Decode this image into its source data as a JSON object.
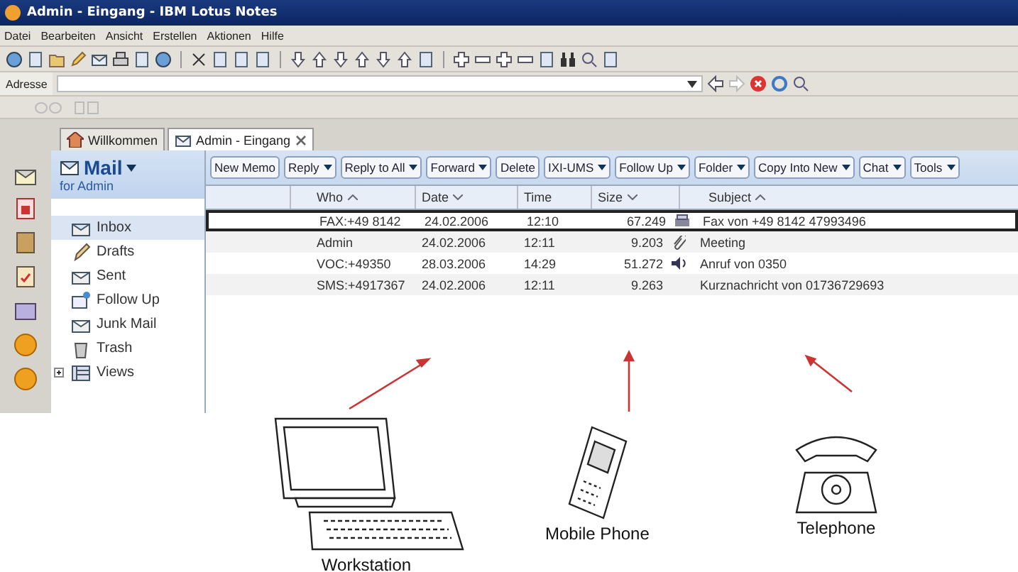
{
  "window": {
    "title": "Admin - Eingang - IBM Lotus Notes"
  },
  "menu": [
    "Datei",
    "Bearbeiten",
    "Ansicht",
    "Erstellen",
    "Aktionen",
    "Hilfe"
  ],
  "address_bar": {
    "label": "Adresse"
  },
  "tabs": [
    {
      "label": "Willkommen",
      "kind": "home",
      "selected": false
    },
    {
      "label": "Admin - Eingang",
      "kind": "mail",
      "selected": true
    }
  ],
  "nav": {
    "title": "Mail",
    "subtitle": "for Admin",
    "items": [
      {
        "label": "Inbox",
        "kind": "inbox",
        "selected": true
      },
      {
        "label": "Drafts",
        "kind": "drafts",
        "selected": false
      },
      {
        "label": "Sent",
        "kind": "sent",
        "selected": false
      },
      {
        "label": "Follow Up",
        "kind": "followup",
        "selected": false
      },
      {
        "label": "Junk Mail",
        "kind": "junk",
        "selected": false
      },
      {
        "label": "Trash",
        "kind": "trash",
        "selected": false
      },
      {
        "label": "Views",
        "kind": "views",
        "selected": false,
        "expanded": false
      }
    ]
  },
  "actions": [
    {
      "label": "New Memo",
      "menu": false
    },
    {
      "label": "Reply",
      "menu": true
    },
    {
      "label": "Reply to All",
      "menu": true
    },
    {
      "label": "Forward",
      "menu": true
    },
    {
      "label": "Delete",
      "menu": false
    },
    {
      "label": "IXI-UMS",
      "menu": true
    },
    {
      "label": "Follow Up",
      "menu": true
    },
    {
      "label": "Folder",
      "menu": true
    },
    {
      "label": "Copy Into New",
      "menu": true
    },
    {
      "label": "Chat",
      "menu": true
    },
    {
      "label": "Tools",
      "menu": true
    }
  ],
  "table": {
    "columns": [
      {
        "label": "Who",
        "sorted": true,
        "ascending": true
      },
      {
        "label": "Date",
        "sorted": true,
        "ascending": false
      },
      {
        "label": "Time",
        "sorted": false
      },
      {
        "label": "Size",
        "sorted": true,
        "ascending": false
      },
      {
        "label": "Subject",
        "sorted": true,
        "ascending": true
      }
    ],
    "rows": [
      {
        "who": "FAX:+49 8142",
        "date": "24.02.2006",
        "time": "12:10",
        "size": "67.249",
        "kind": "fax",
        "subject": "Fax von +49 8142 47993496",
        "selected": true
      },
      {
        "who": "Admin",
        "date": "24.02.2006",
        "time": "12:11",
        "size": "9.203",
        "kind": "attachment",
        "subject": "Meeting",
        "selected": false
      },
      {
        "who": "VOC:+49350",
        "date": "28.03.2006",
        "time": "14:29",
        "size": "51.272",
        "kind": "voice",
        "subject": "Anruf von 0350",
        "selected": false
      },
      {
        "who": "SMS:+4917367",
        "date": "24.02.2006",
        "time": "12:11",
        "size": "9.263",
        "kind": "sms",
        "subject": "Kurznachricht von 01736729693",
        "selected": false
      }
    ]
  },
  "devices": [
    {
      "kind": "workstation",
      "label": "Workstation"
    },
    {
      "kind": "phone",
      "label": "Mobile Phone"
    },
    {
      "kind": "telephone",
      "label": "Telephone"
    }
  ]
}
